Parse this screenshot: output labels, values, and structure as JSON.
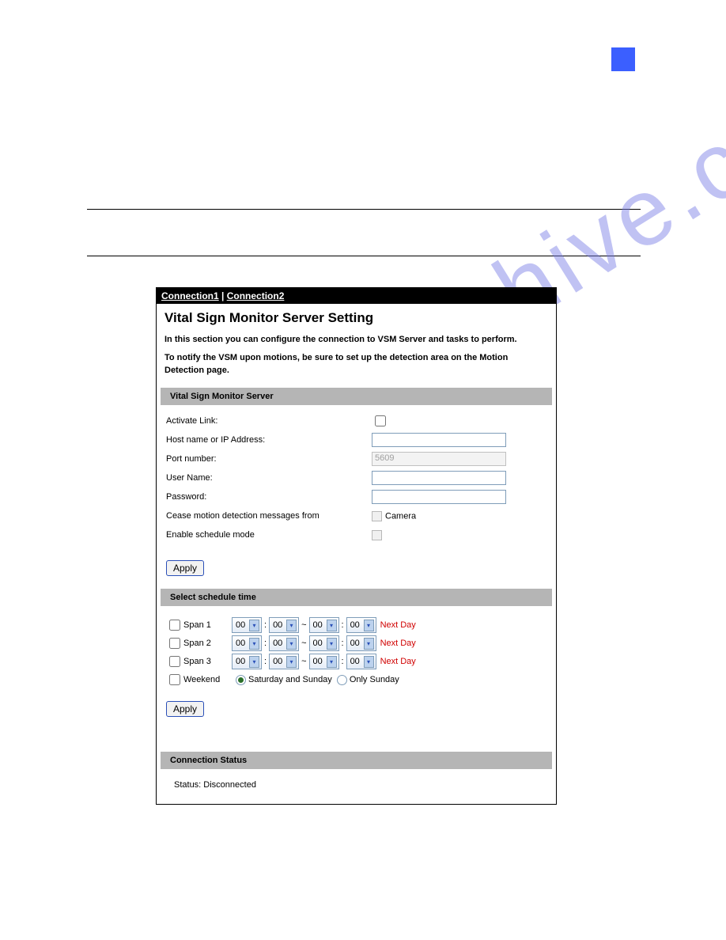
{
  "watermark": "manualshive.com",
  "tabs": {
    "tab1": "Connection1",
    "sep": " | ",
    "tab2": "Connection2"
  },
  "title": "Vital Sign Monitor Server Setting",
  "intro1": "In this section you can configure the connection to VSM Server and tasks to perform.",
  "intro2": "To notify the VSM upon motions, be sure to set up the detection area on the Motion Detection page.",
  "section1": "Vital Sign Monitor Server",
  "fields": {
    "activate": "Activate Link:",
    "host": "Host name or IP Address:",
    "port": "Port number:",
    "port_value": "5609",
    "user": "User Name:",
    "pass": "Password:",
    "cease": "Cease motion detection messages from",
    "camera": "Camera",
    "sched": "Enable schedule mode"
  },
  "apply": "Apply",
  "section2": "Select schedule time",
  "sched_rows": {
    "span1": "Span 1",
    "span2": "Span 2",
    "span3": "Span 3",
    "weekend": "Weekend",
    "dd": "00",
    "colon": ":",
    "tilde": "~",
    "nextday": "Next Day",
    "opt_satSun": "Saturday and Sunday",
    "opt_onlySun": "Only Sunday"
  },
  "section3": "Connection Status",
  "status": "Status: Disconnected"
}
